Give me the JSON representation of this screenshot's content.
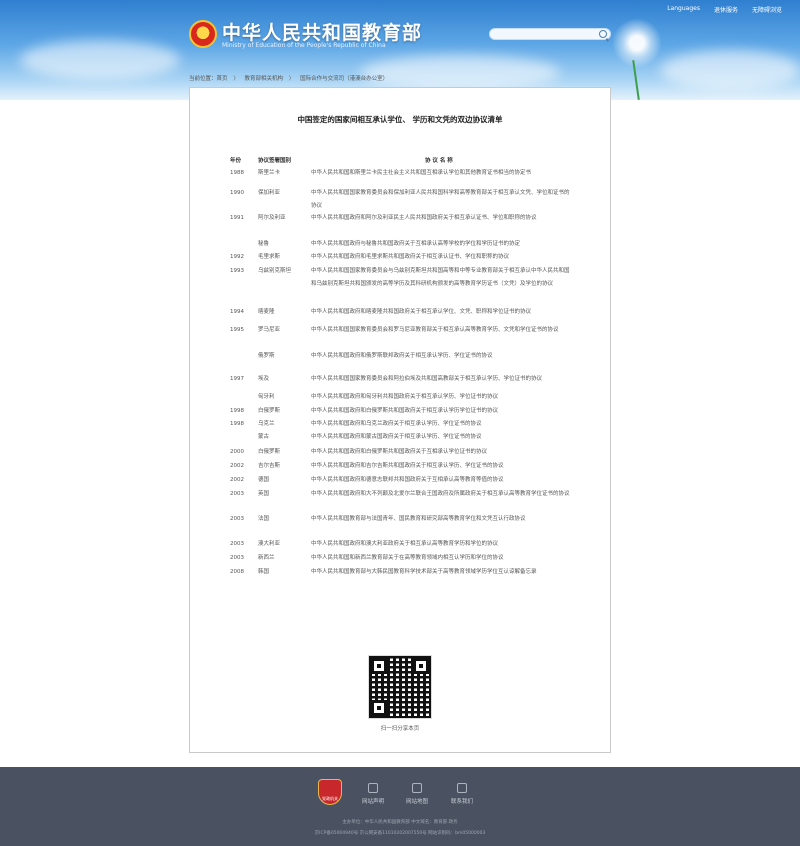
{
  "header": {
    "title_cn": "中华人民共和国教育部",
    "title_en": "Ministry of Education of the People's Republic of China",
    "links": [
      "Languages",
      "退休服务",
      "无障碍浏览"
    ]
  },
  "breadcrumb": [
    "当前位置：首页",
    "教育部相关机构",
    "国际合作与交流司（港澳台办公室）"
  ],
  "document": {
    "title": "中国签定的国家间相互承认学位、 学历和文凭的双边协议清单",
    "headers": {
      "year": "年份",
      "country": "协议签署国别",
      "name": "协 议 名 称"
    },
    "rows": [
      {
        "year": "1988",
        "country": "斯里兰卡",
        "name": "中华人民共和国和斯里兰卡民主社会主义共和国互相承认学位和其他教育证书相当的协定书"
      },
      {
        "year": "1990",
        "country": "保加利亚",
        "name": "中华人民共和国国家教育委员会和保加利亚人民共和国科学和高等教育部关于相互承认文凭、学位和证书的协议"
      },
      {
        "year": "1991",
        "country": "阿尔及利亚",
        "name": "中华人民共和国政府和阿尔及利亚民主人民共和国政府关于相互承认证书、学位和职称的协议"
      },
      {
        "year": "",
        "country": "秘鲁",
        "name": "中华人民共和国政府与秘鲁共和国政府关于互相承认高等学校的学位和学历证书的协定"
      },
      {
        "year": "1992",
        "country": "毛里求斯",
        "name": "中华人民共和国政府和毛里求斯共和国政府关于相互承认证书、学位和职称的协议"
      },
      {
        "year": "1993",
        "country": "乌兹别克斯坦",
        "name": "中华人民共和国国家教育委员会与乌兹别克斯坦共和国高等和中等专业教育部关于相互承认中华人民共和国和乌兹别克斯坦共和国颁发的高等学历及其科研机构颁发的高等教育学历证书（文凭）及学位的协议"
      },
      {
        "year": "1994",
        "country": "喀麦隆",
        "name": "中华人民共和国政府和喀麦隆共和国政府关于相互承认学位、文凭、职称和学位证书的协议"
      },
      {
        "year": "1995",
        "country": "罗马尼亚",
        "name": "中华人民共和国国家教育委员会和罗马尼亚教育部关于相互承认高等教育学历、文凭和学位证书的协议"
      },
      {
        "year": "",
        "country": "俄罗斯",
        "name": "中华人民共和国政府和俄罗斯联邦政府关于相互承认学历、学位证书的协议"
      },
      {
        "year": "1997",
        "country": "埃及",
        "name": "中华人民共和国国家教育委员会和阿拉伯埃及共和国高教部关于相互承认学历、学位证书的协议"
      },
      {
        "year": "",
        "country": "匈牙利",
        "name": "中华人民共和国政府和匈牙利共和国政府关于相互承认学历、学位证书的协议"
      },
      {
        "year": "1998",
        "country": "白俄罗斯",
        "name": "中华人民共和国政府和白俄罗斯共和国政府关于相互承认学历学位证书的协议"
      },
      {
        "year": "1998",
        "country": "乌克兰",
        "name": "中华人民共和国政府和乌克兰政府关于相互承认学历、学位证书的协议"
      },
      {
        "year": "",
        "country": "蒙古",
        "name": "中华人民共和国政府和蒙古国政府关于相互承认学历、学位证书的协议"
      },
      {
        "year": "2000",
        "country": "白俄罗斯",
        "name": "中华人民共和国政府和白俄罗斯共和国政府关于互相承认学位证书的协议"
      },
      {
        "year": "2002",
        "country": "吉尔吉斯",
        "name": "中华人民共和国政府和吉尔吉斯共和国政府关于相互承认学历、学位证书的协议"
      },
      {
        "year": "2002",
        "country": "德国",
        "name": "中华人民共和国政府和德意志联邦共和国政府关于互相承认高等教育等值的协议"
      },
      {
        "year": "2003",
        "country": "英国",
        "name": "中华人民共和国政府和大不列颠及北爱尔兰联合王国政府及所属政府关于相互承认高等教育学位证书的协议"
      },
      {
        "year": "2003",
        "country": "法国",
        "name": "中华人民共和国教育部与法国青年、国民教育和研究部高等教育学位和文凭互认行政协议"
      },
      {
        "year": "2003",
        "country": "澳大利亚",
        "name": "中华人民共和国政府和澳大利亚政府关于相互承认高等教育学历和学位的协议"
      },
      {
        "year": "2003",
        "country": "新西兰",
        "name": "中华人民共和国和新西兰教育部关于在高等教育领域内相互认学历和学位的协议"
      },
      {
        "year": "2008",
        "country": "韩国",
        "name": "中华人民共和国教育部与大韩民国教育科学技术部关于高等教育领域学历学位互认谅解备忘录"
      }
    ],
    "qr_caption": "扫一扫分享本页"
  },
  "footer": {
    "logo_text": "党政机关",
    "links": [
      "网站声明",
      "网站地图",
      "联系我们"
    ],
    "info1": "主办单位：中华人民共和国教育部   中文域名：教育部.政务",
    "info2": "京ICP备05004940号  京公网安备11010202007550号  网站识别码：bm05000003"
  }
}
